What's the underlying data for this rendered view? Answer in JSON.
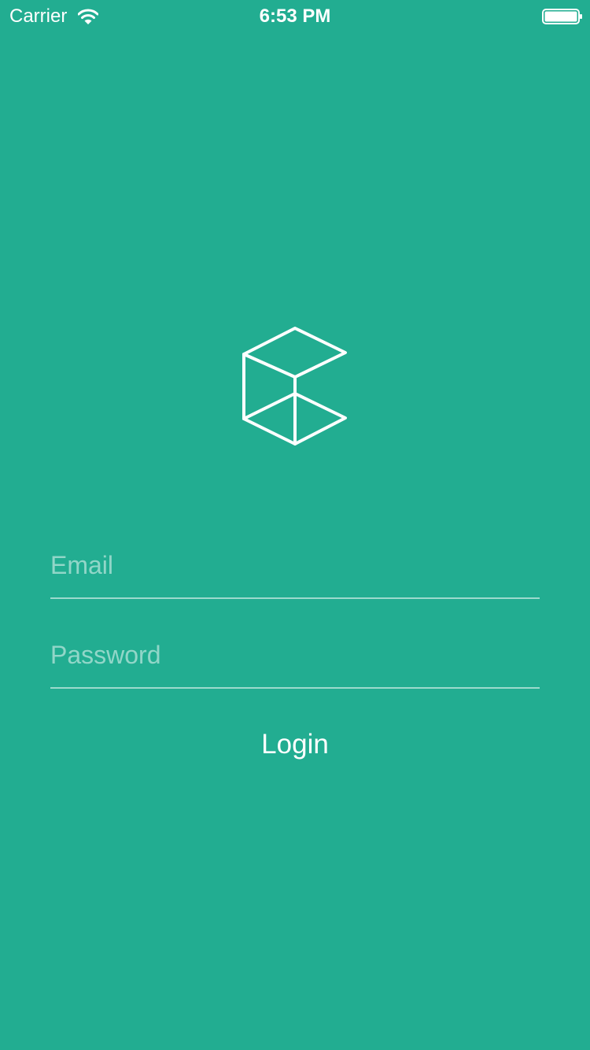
{
  "status_bar": {
    "carrier": "Carrier",
    "wifi_icon": "wifi-icon",
    "time": "6:53 PM",
    "battery_icon": "battery-full-icon",
    "battery_level": 1.0
  },
  "app": {
    "logo_icon": "cube-outline-icon",
    "background_color": "#22AD91",
    "foreground_color": "#FFFFFF"
  },
  "form": {
    "email": {
      "placeholder": "Email",
      "value": ""
    },
    "password": {
      "placeholder": "Password",
      "value": ""
    },
    "login_label": "Login"
  }
}
